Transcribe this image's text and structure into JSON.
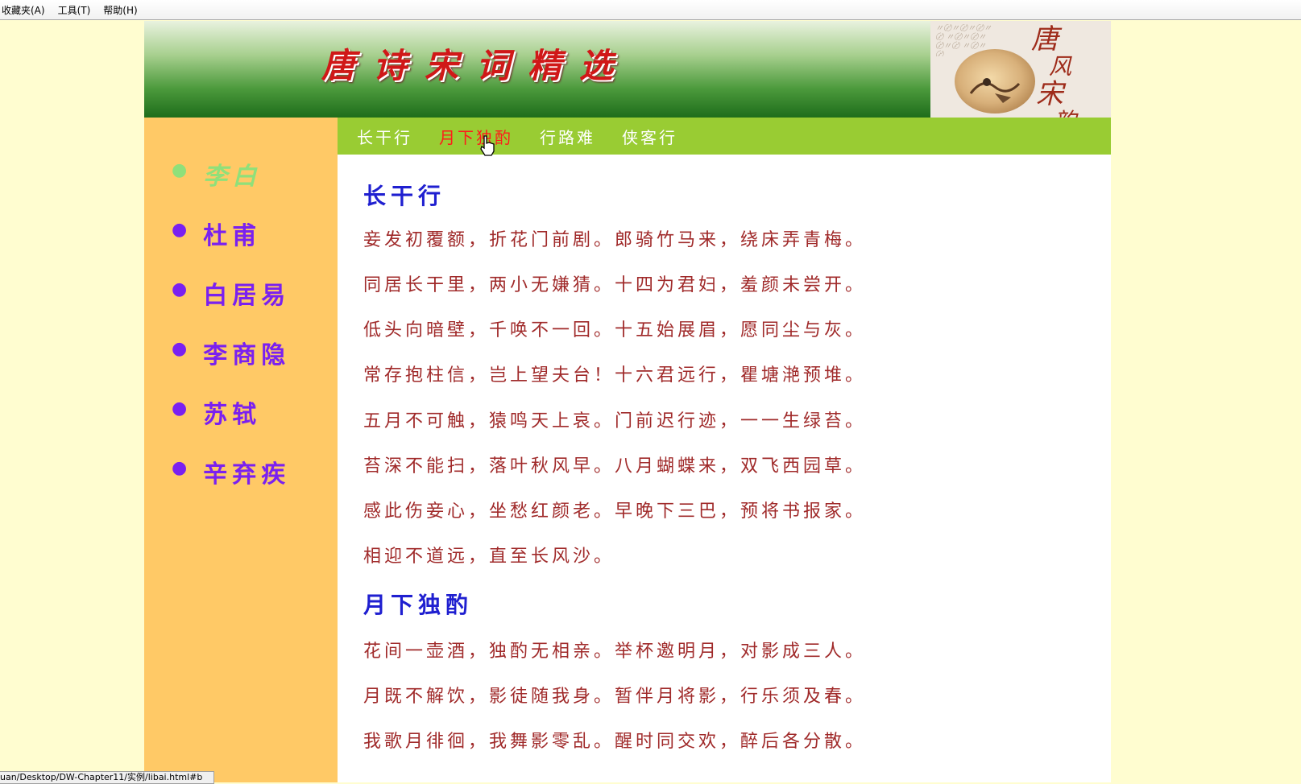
{
  "menu": [
    "收藏夹(A)",
    "工具(T)",
    "帮助(H)"
  ],
  "banner": {
    "title": "唐诗宋词精选",
    "art_text": [
      "唐",
      "风",
      "宋",
      "韵"
    ]
  },
  "sidebar": {
    "items": [
      "李白",
      "杜甫",
      "白居易",
      "李商隐",
      "苏轼",
      "辛弃疾"
    ],
    "active_index": 0
  },
  "nav": {
    "items": [
      "长干行",
      "月下独酌",
      "行路难",
      "侠客行"
    ],
    "hover_index": 1
  },
  "poems": [
    {
      "title": "长干行",
      "lines": [
        "妾发初覆额，折花门前剧。郎骑竹马来，绕床弄青梅。",
        "同居长干里，两小无嫌猜。十四为君妇，羞颜未尝开。",
        "低头向暗壁，千唤不一回。十五始展眉，愿同尘与灰。",
        "常存抱柱信，岂上望夫台！十六君远行，瞿塘滟预堆。",
        "五月不可触，猿鸣天上哀。门前迟行迹，一一生绿苔。",
        "苔深不能扫，落叶秋风早。八月蝴蝶来，双飞西园草。",
        "感此伤妾心，坐愁红颜老。早晚下三巴，预将书报家。",
        "相迎不道远，直至长风沙。"
      ]
    },
    {
      "title": "月下独酌",
      "lines": [
        "花间一壶酒，独酌无相亲。举杯邀明月，对影成三人。",
        "月既不解饮，影徒随我身。暂伴月将影，行乐须及春。",
        "我歌月徘徊，我舞影零乱。醒时同交欢，醉后各分散。"
      ]
    }
  ],
  "status_text": "uan/Desktop/DW-Chapter11/实例/libai.html#b",
  "colors": {
    "page_bg": "#fffdd0",
    "sidebar_bg": "#ffc966",
    "nav_bg": "#99cc33",
    "nav_hover": "#ff1a1a",
    "sidebar_link": "#7a20f0",
    "sidebar_active": "#8fe07a",
    "poem_title": "#1f1fd0",
    "poem_text": "#a02a2a"
  }
}
